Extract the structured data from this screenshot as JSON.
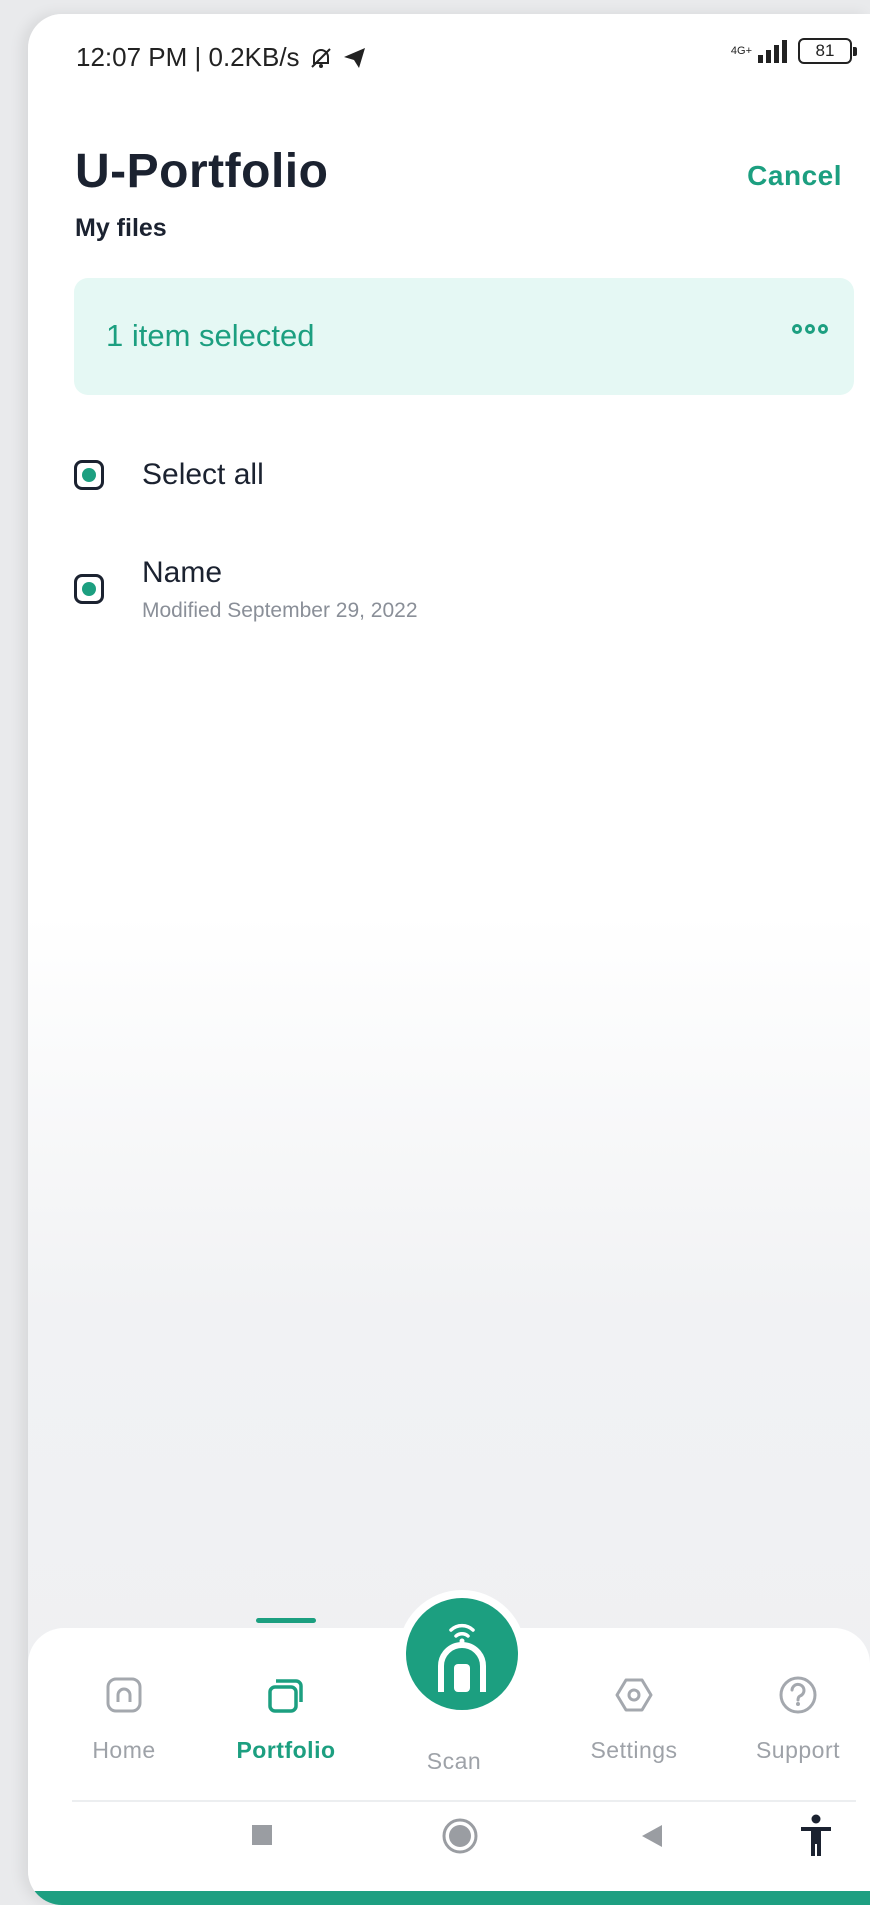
{
  "status_bar": {
    "time_speed": "12:07 PM | 0.2KB/s",
    "network": "4G+",
    "battery": "81"
  },
  "header": {
    "title": "U-Portfolio",
    "subtitle": "My files",
    "cancel_label": "Cancel"
  },
  "selection": {
    "banner_text": "1 item selected",
    "select_all_label": "Select all"
  },
  "files": [
    {
      "name": "Name",
      "modified": "Modified September 29, 2022",
      "selected": true
    }
  ],
  "bottom_nav": {
    "items": [
      {
        "label": "Home",
        "icon": "home-icon"
      },
      {
        "label": "Portfolio",
        "icon": "portfolio-icon",
        "active": true
      },
      {
        "label": "Scan",
        "icon": "scan-icon"
      },
      {
        "label": "Settings",
        "icon": "settings-icon"
      },
      {
        "label": "Support",
        "icon": "support-icon"
      }
    ]
  },
  "colors": {
    "accent": "#1c9f80",
    "banner_bg": "#e5f8f4",
    "text_dark": "#1b2230"
  }
}
